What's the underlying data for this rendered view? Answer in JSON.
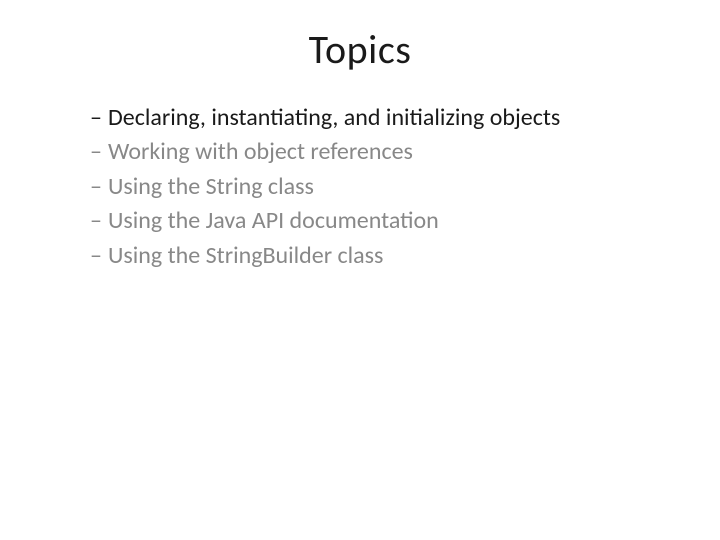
{
  "title": "Topics",
  "items": [
    {
      "text": "Declaring, instantiating, and initializing objects",
      "active": true
    },
    {
      "text": "Working with object references",
      "active": false
    },
    {
      "text": "Using the String class",
      "active": false
    },
    {
      "text": "Using the Java API documentation",
      "active": false
    },
    {
      "text": "Using the StringBuilder class",
      "active": false
    }
  ]
}
